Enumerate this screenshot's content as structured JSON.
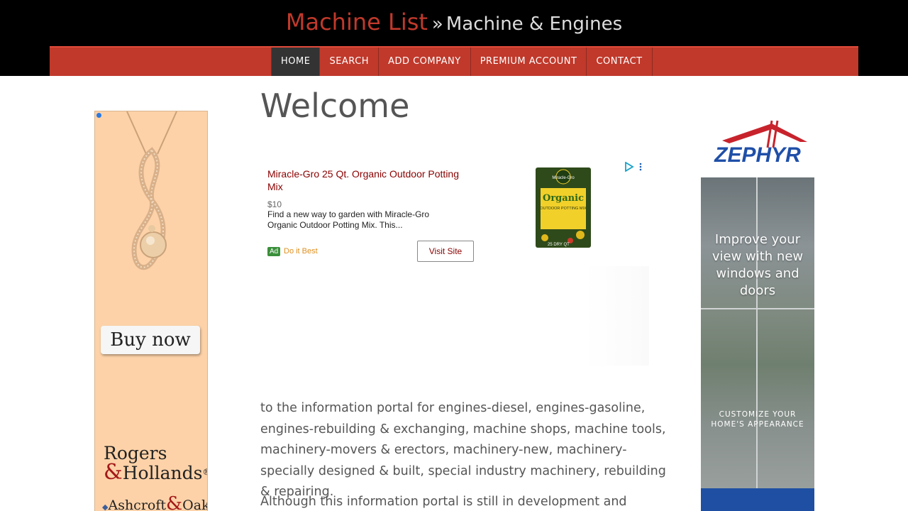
{
  "header": {
    "brand": "Machine List",
    "separator": "»",
    "subtitle": "Machine & Engines"
  },
  "nav": {
    "items": [
      {
        "label": "HOME",
        "active": true
      },
      {
        "label": "SEARCH",
        "active": false
      },
      {
        "label": "ADD COMPANY",
        "active": false
      },
      {
        "label": "PREMIUM ACCOUNT",
        "active": false
      },
      {
        "label": "CONTACT",
        "active": false
      }
    ]
  },
  "left_ad": {
    "button": "Buy now",
    "brand_line1": "Rogers",
    "brand_amp": "&",
    "brand_line2": "Hollands",
    "brand_reg": "®",
    "sub_brand_1": "Ashcroft",
    "sub_brand_amp": "&",
    "sub_brand_2": "Oak"
  },
  "main": {
    "heading": "Welcome",
    "paragraph1": "to the information portal for engines-diesel, engines-gasoline, engines-rebuilding & exchanging, machine shops, machine tools, machinery-movers & erectors, machinery-new, machinery-specially designed & built, special industry machinery, rebuilding & repairing.",
    "paragraph2": "Although this information portal is still in development and"
  },
  "inline_ad": {
    "title": "Miracle-Gro 25 Qt. Organic Outdoor Potting Mix",
    "price": "$10",
    "description": "Find a new way to garden with Miracle-Gro Organic Outdoor Potting Mix. This...",
    "badge": "Ad",
    "advertiser": "Do it Best",
    "button": "Visit Site",
    "product_brand": "Miracle-Gro",
    "product_name": "Organic",
    "product_line": "OUTDOOR POTTING MIX",
    "product_size": "25 DRY QT"
  },
  "right_ad": {
    "logo": "ZEPHYR",
    "headline": "Improve your view with new windows and doors",
    "cta": "CUSTOMIZE YOUR HOME'S APPEARANCE"
  },
  "colors": {
    "brand_red": "#c0392b",
    "nav_active": "#333333",
    "header_bg": "#000000",
    "text": "#555555"
  }
}
